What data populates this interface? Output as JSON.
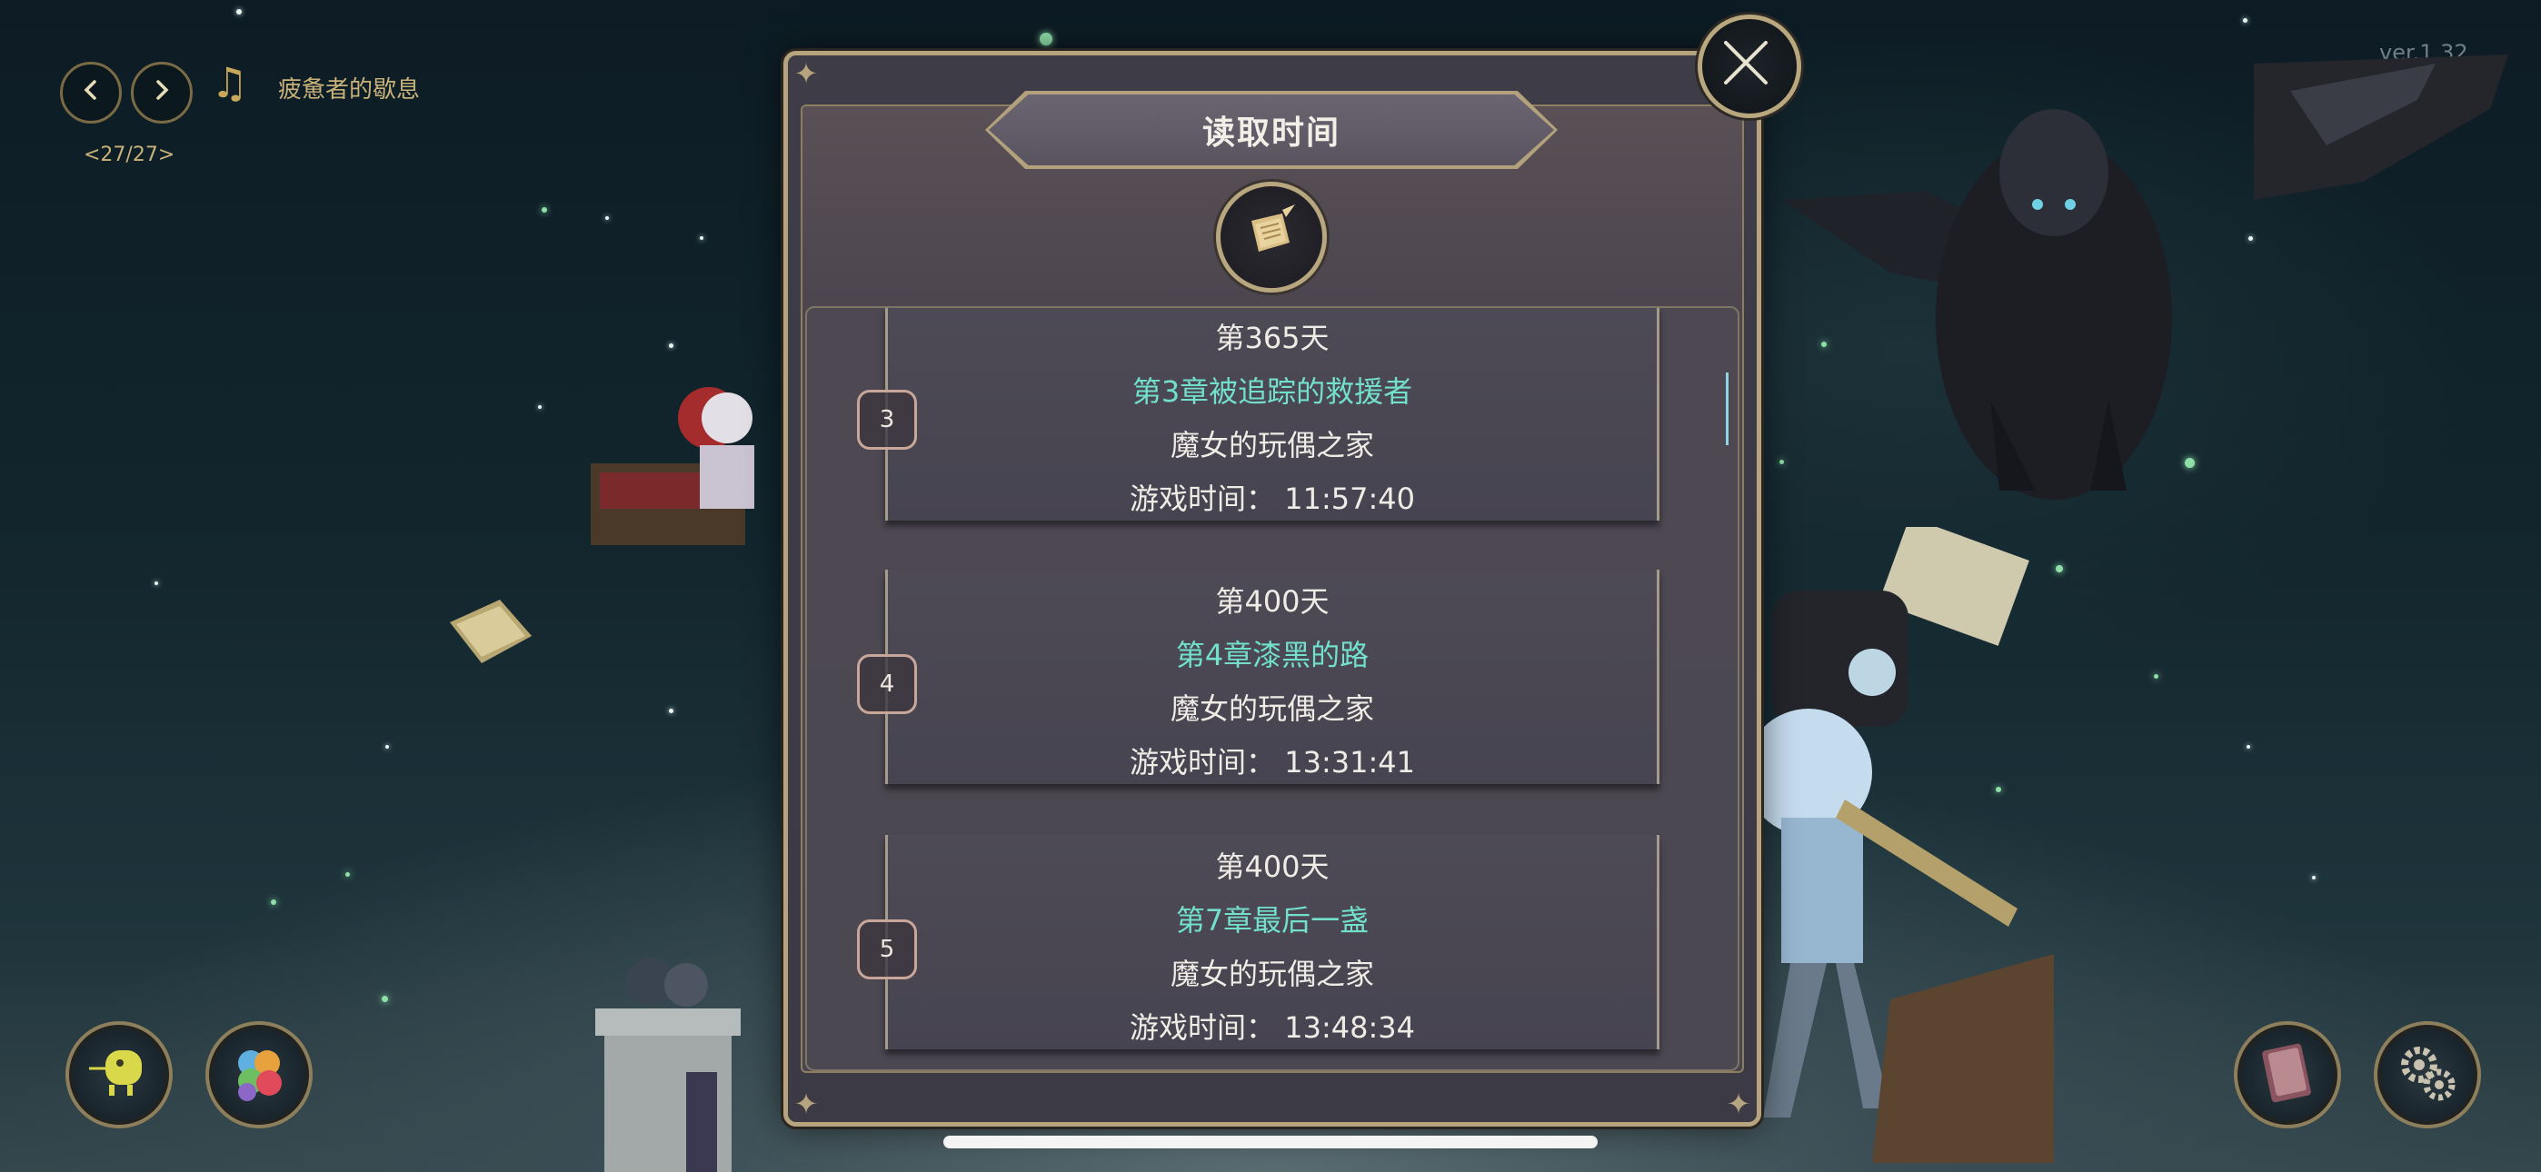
{
  "version": "ver.1.32",
  "music": {
    "prev_icon": "chevron-left-icon",
    "next_icon": "chevron-right-icon",
    "note_icon": "music-note-icon",
    "title": "疲惫者的歇息",
    "track_counter": "<27/27>"
  },
  "dialog": {
    "title": "读取时间",
    "emblem_icon": "scroll-quill-icon",
    "close_icon": "close-icon",
    "slots": [
      {
        "number": "3",
        "day": "第365天",
        "chapter": "第3章被追踪的救援者",
        "location": "魔女的玩偶之家",
        "play_time": "游戏时间： 11:57:40"
      },
      {
        "number": "4",
        "day": "第400天",
        "chapter": "第4章漆黑的路",
        "location": "魔女的玩偶之家",
        "play_time": "游戏时间： 13:31:41"
      },
      {
        "number": "5",
        "day": "第400天",
        "chapter": "第7章最后一盏",
        "location": "魔女的玩偶之家",
        "play_time": "游戏时间： 13:48:34"
      }
    ]
  },
  "bottom_buttons": {
    "left1_icon": "character-icon",
    "left2_icon": "color-palette-icon",
    "right1_icon": "book-icon",
    "right2_icon": "settings-gears-icon"
  },
  "colors": {
    "gold": "#b6a47e",
    "chapter_text": "#72e0cc",
    "panel": "#3d3c47"
  }
}
